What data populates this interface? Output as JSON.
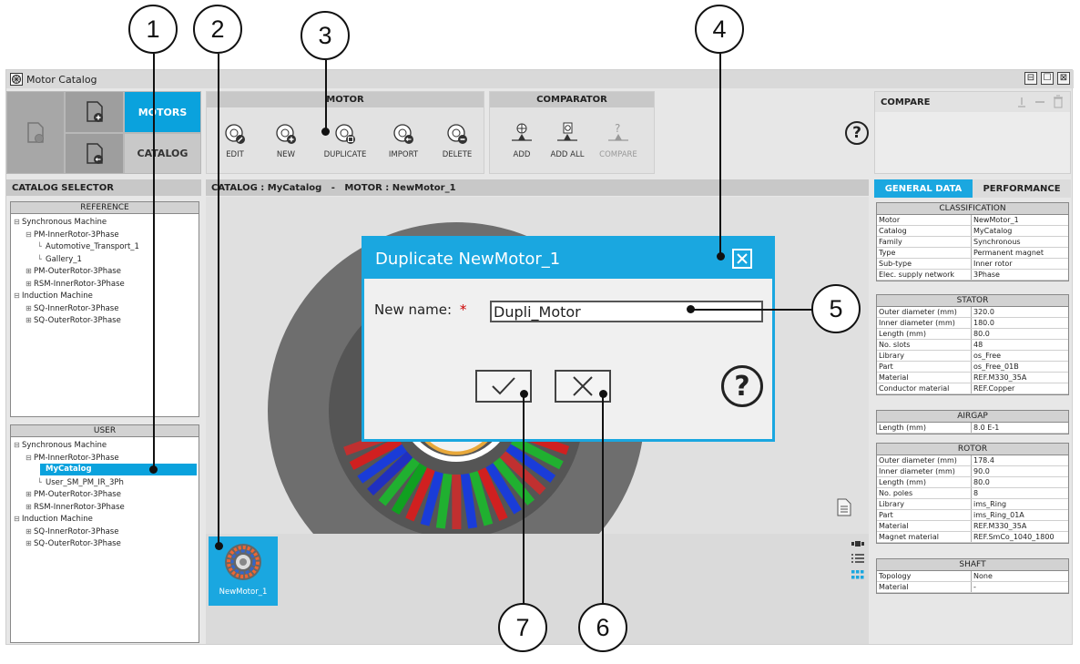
{
  "callouts": [
    "1",
    "2",
    "3",
    "4",
    "5",
    "6",
    "7"
  ],
  "window": {
    "title": "Motor Catalog",
    "controls": [
      "⊟",
      "☐",
      "⊠"
    ]
  },
  "nav": {
    "motors_label": "MOTORS",
    "catalog_label": "CATALOG"
  },
  "motor_panel": {
    "title": "MOTOR",
    "buttons": [
      {
        "label": "EDIT",
        "icon": "edit-motor-icon"
      },
      {
        "label": "NEW",
        "icon": "new-motor-icon"
      },
      {
        "label": "DUPLICATE",
        "icon": "duplicate-motor-icon"
      },
      {
        "label": "IMPORT",
        "icon": "import-motor-icon"
      },
      {
        "label": "DELETE",
        "icon": "delete-motor-icon"
      }
    ]
  },
  "comparator_panel": {
    "title": "COMPARATOR",
    "buttons": [
      {
        "label": "ADD",
        "icon": "add-compare-icon"
      },
      {
        "label": "ADD ALL",
        "icon": "add-all-compare-icon"
      },
      {
        "label": "COMPARE",
        "icon": "compare-icon"
      }
    ]
  },
  "compare_panel": {
    "title": "COMPARE",
    "help": "?"
  },
  "catalog_selector": {
    "title": "CATALOG SELECTOR",
    "reference": {
      "title": "REFERENCE",
      "items": [
        {
          "label": "Synchronous Machine",
          "level": 0,
          "sign": "⊟"
        },
        {
          "label": "PM-InnerRotor-3Phase",
          "level": 1,
          "sign": "⊟"
        },
        {
          "label": "Automotive_Transport_1",
          "level": 2,
          "sign": ""
        },
        {
          "label": "Gallery_1",
          "level": 2,
          "sign": ""
        },
        {
          "label": "PM-OuterRotor-3Phase",
          "level": 1,
          "sign": "⊞"
        },
        {
          "label": "RSM-InnerRotor-3Phase",
          "level": 1,
          "sign": "⊞"
        },
        {
          "label": "Induction Machine",
          "level": 0,
          "sign": "⊟"
        },
        {
          "label": "SQ-InnerRotor-3Phase",
          "level": 1,
          "sign": "⊞"
        },
        {
          "label": "SQ-OuterRotor-3Phase",
          "level": 1,
          "sign": "⊞"
        }
      ]
    },
    "user": {
      "title": "USER",
      "items": [
        {
          "label": "Synchronous Machine",
          "level": 0,
          "sign": "⊟"
        },
        {
          "label": "PM-InnerRotor-3Phase",
          "level": 1,
          "sign": "⊟"
        },
        {
          "label": "MyCatalog",
          "level": 2,
          "sign": "",
          "selected": true
        },
        {
          "label": "User_SM_PM_IR_3Ph",
          "level": 2,
          "sign": ""
        },
        {
          "label": "PM-OuterRotor-3Phase",
          "level": 1,
          "sign": "⊞"
        },
        {
          "label": "RSM-InnerRotor-3Phase",
          "level": 1,
          "sign": "⊞"
        },
        {
          "label": "Induction Machine",
          "level": 0,
          "sign": "⊟"
        },
        {
          "label": "SQ-InnerRotor-3Phase",
          "level": 1,
          "sign": "⊞"
        },
        {
          "label": "SQ-OuterRotor-3Phase",
          "level": 1,
          "sign": "⊞"
        }
      ]
    }
  },
  "breadcrumb": "CATALOG : MyCatalog   -   MOTOR : NewMotor_1",
  "thumbnail": {
    "label": "NewMotor_1"
  },
  "tabs": {
    "general": "GENERAL DATA",
    "performance": "PERFORMANCE"
  },
  "tables": [
    {
      "title": "CLASSIFICATION",
      "rows": [
        [
          "Motor",
          "NewMotor_1"
        ],
        [
          "Catalog",
          "MyCatalog"
        ],
        [
          "Family",
          "Synchronous"
        ],
        [
          "Type",
          "Permanent magnet"
        ],
        [
          "Sub-type",
          "Inner rotor"
        ],
        [
          "Elec. supply network",
          "3Phase"
        ]
      ]
    },
    {
      "title": "STATOR",
      "rows": [
        [
          "Outer diameter (mm)",
          "320.0"
        ],
        [
          "Inner diameter (mm)",
          "180.0"
        ],
        [
          "Length (mm)",
          "80.0"
        ],
        [
          "No. slots",
          "48"
        ],
        [
          "Library",
          "os_Free"
        ],
        [
          "Part",
          "os_Free_01B"
        ],
        [
          "Material",
          "REF.M330_35A"
        ],
        [
          "Conductor material",
          "REF.Copper"
        ]
      ]
    },
    {
      "title": "AIRGAP",
      "rows": [
        [
          "Length (mm)",
          "8.0 E-1"
        ]
      ]
    },
    {
      "title": "ROTOR",
      "rows": [
        [
          "Outer diameter (mm)",
          "178.4"
        ],
        [
          "Inner diameter (mm)",
          "90.0"
        ],
        [
          "Length (mm)",
          "80.0"
        ],
        [
          "No. poles",
          "8"
        ],
        [
          "Library",
          "ims_Ring"
        ],
        [
          "Part",
          "ims_Ring_01A"
        ],
        [
          "Material",
          "REF.M330_35A"
        ],
        [
          "Magnet material",
          "REF.SmCo_1040_1800"
        ]
      ]
    },
    {
      "title": "SHAFT",
      "rows": [
        [
          "Topology",
          "None"
        ],
        [
          "Material",
          "-"
        ]
      ]
    }
  ],
  "dialog": {
    "title": "Duplicate NewMotor_1",
    "name_label": "New name:",
    "required_mark": "*",
    "name_value": "Dupli_Motor",
    "help": "?"
  },
  "colors": {
    "accent": "#1aa7e0",
    "panel": "#e7e7e7",
    "header": "#c8c8c8"
  }
}
